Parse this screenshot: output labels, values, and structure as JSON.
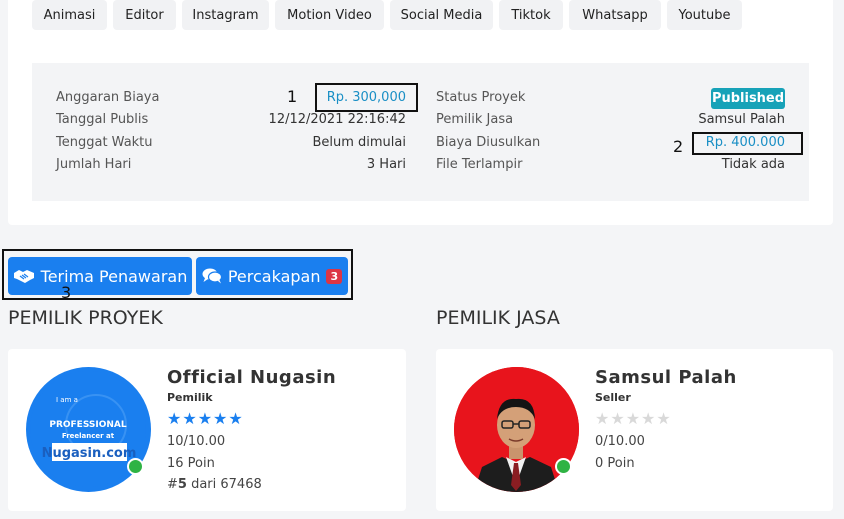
{
  "tags": [
    "Animasi",
    "Editor",
    "Instagram",
    "Motion Video",
    "Social Media",
    "Tiktok",
    "Whatsapp",
    "Youtube"
  ],
  "info": {
    "budget_label": "Anggaran Biaya",
    "budget_value": "Rp. 300,000",
    "publish_label": "Tanggal Publis",
    "publish_value": "12/12/2021 22:16:42",
    "deadline_label": "Tenggat Waktu",
    "deadline_value": "Belum dimulai",
    "days_label": "Jumlah Hari",
    "days_value": "3 Hari",
    "status_label": "Status Proyek",
    "status_value": "Published",
    "owner_label": "Pemilik Jasa",
    "owner_value": "Samsul Palah",
    "proposed_label": "Biaya Diusulkan",
    "proposed_value": "Rp. 400.000",
    "file_label": "File Terlampir",
    "file_value": "Tidak ada"
  },
  "markers": {
    "m1": "1",
    "m2": "2",
    "m3": "3"
  },
  "actions": {
    "accept_label": "Terima Penawaran",
    "chat_label": "Percakapan",
    "chat_count": "3"
  },
  "sections": {
    "project_owner": "PEMILIK PROYEK",
    "service_owner": "PEMILIK JASA"
  },
  "project_owner": {
    "name": "Official Nugasin",
    "role": "Pemilik",
    "rating_text": "10/10.00",
    "points": "16 Poin",
    "rank_prefix": "#",
    "rank_num": "5",
    "rank_suffix": " dari 67468",
    "logo_small": "I am a",
    "logo_line1": "PROFESSIONAL",
    "logo_line2": "Freelancer at",
    "logo_brand": "Nugasin.com",
    "stars_filled": 5
  },
  "service_owner": {
    "name": "Samsul Palah",
    "role": "Seller",
    "rating_text": "0/10.00",
    "points": "0 Poin",
    "stars_filled": 0
  },
  "colors": {
    "primary": "#1a7fef",
    "info_badge": "#17a2b8",
    "danger": "#dc3545",
    "online": "#2fb344",
    "star_on": "#1a7fef",
    "star_off": "#d9d9d9"
  }
}
